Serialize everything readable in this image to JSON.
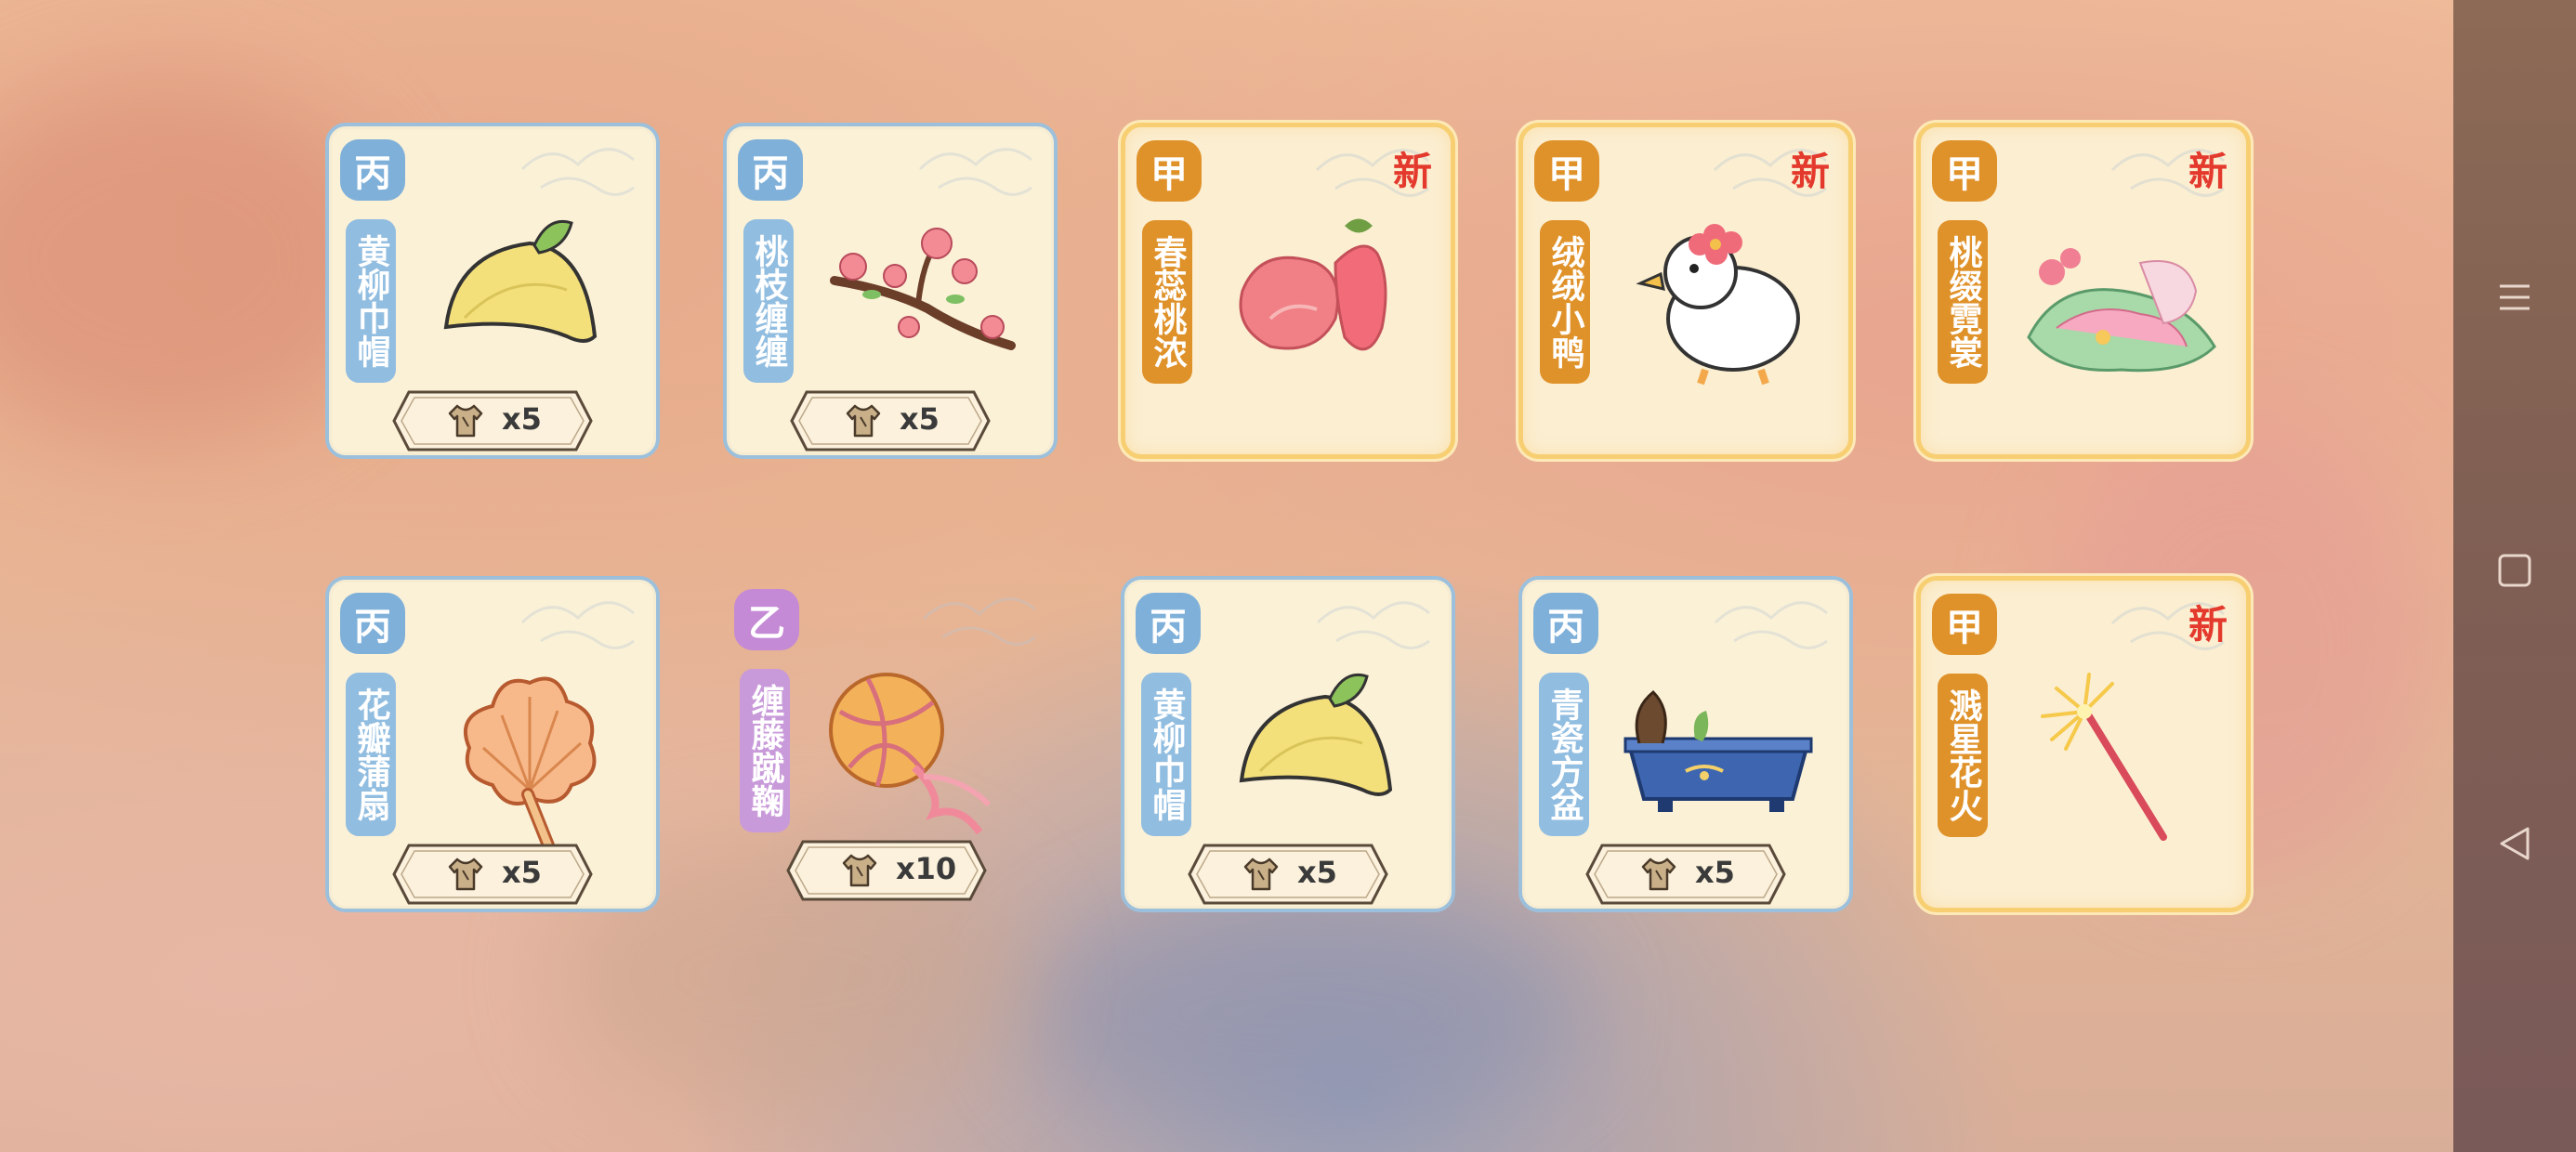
{
  "navbar": {
    "icons": [
      "menu-icon",
      "home-square-icon",
      "back-triangle-icon"
    ]
  },
  "colors": {
    "common_border": "#9cc0dc",
    "rare_border": "#e7b7d3",
    "epic_border": "#f7cf72",
    "new_tag": "#e43a2e"
  },
  "items": [
    {
      "grade": "丙",
      "name": "黄柳巾帽",
      "qty": "x5",
      "new": "",
      "tier": "blue",
      "icon": "yellow-hat-icon"
    },
    {
      "grade": "丙",
      "name": "桃枝缠缠",
      "qty": "x5",
      "new": "",
      "tier": "blue",
      "icon": "peach-branch-icon"
    },
    {
      "grade": "甲",
      "name": "春蕊桃浓",
      "qty": "",
      "new": "新",
      "tier": "gold",
      "icon": "peach-flower-icon"
    },
    {
      "grade": "甲",
      "name": "绒绒小鸭",
      "qty": "",
      "new": "新",
      "tier": "gold",
      "icon": "duck-icon"
    },
    {
      "grade": "甲",
      "name": "桃缀霓裳",
      "qty": "",
      "new": "新",
      "tier": "gold",
      "icon": "dress-icon"
    },
    {
      "grade": "丙",
      "name": "花瓣蒲扇",
      "qty": "x5",
      "new": "",
      "tier": "blue",
      "icon": "petal-fan-icon"
    },
    {
      "grade": "乙",
      "name": "缠藤蹴鞠",
      "qty": "x10",
      "new": "",
      "tier": "purple",
      "icon": "ball-icon"
    },
    {
      "grade": "丙",
      "name": "黄柳巾帽",
      "qty": "x5",
      "new": "",
      "tier": "blue",
      "icon": "yellow-hat-icon"
    },
    {
      "grade": "丙",
      "name": "青瓷方盆",
      "qty": "x5",
      "new": "",
      "tier": "blue",
      "icon": "planter-icon"
    },
    {
      "grade": "甲",
      "name": "溅星花火",
      "qty": "",
      "new": "新",
      "tier": "gold",
      "icon": "sparkler-icon"
    }
  ]
}
